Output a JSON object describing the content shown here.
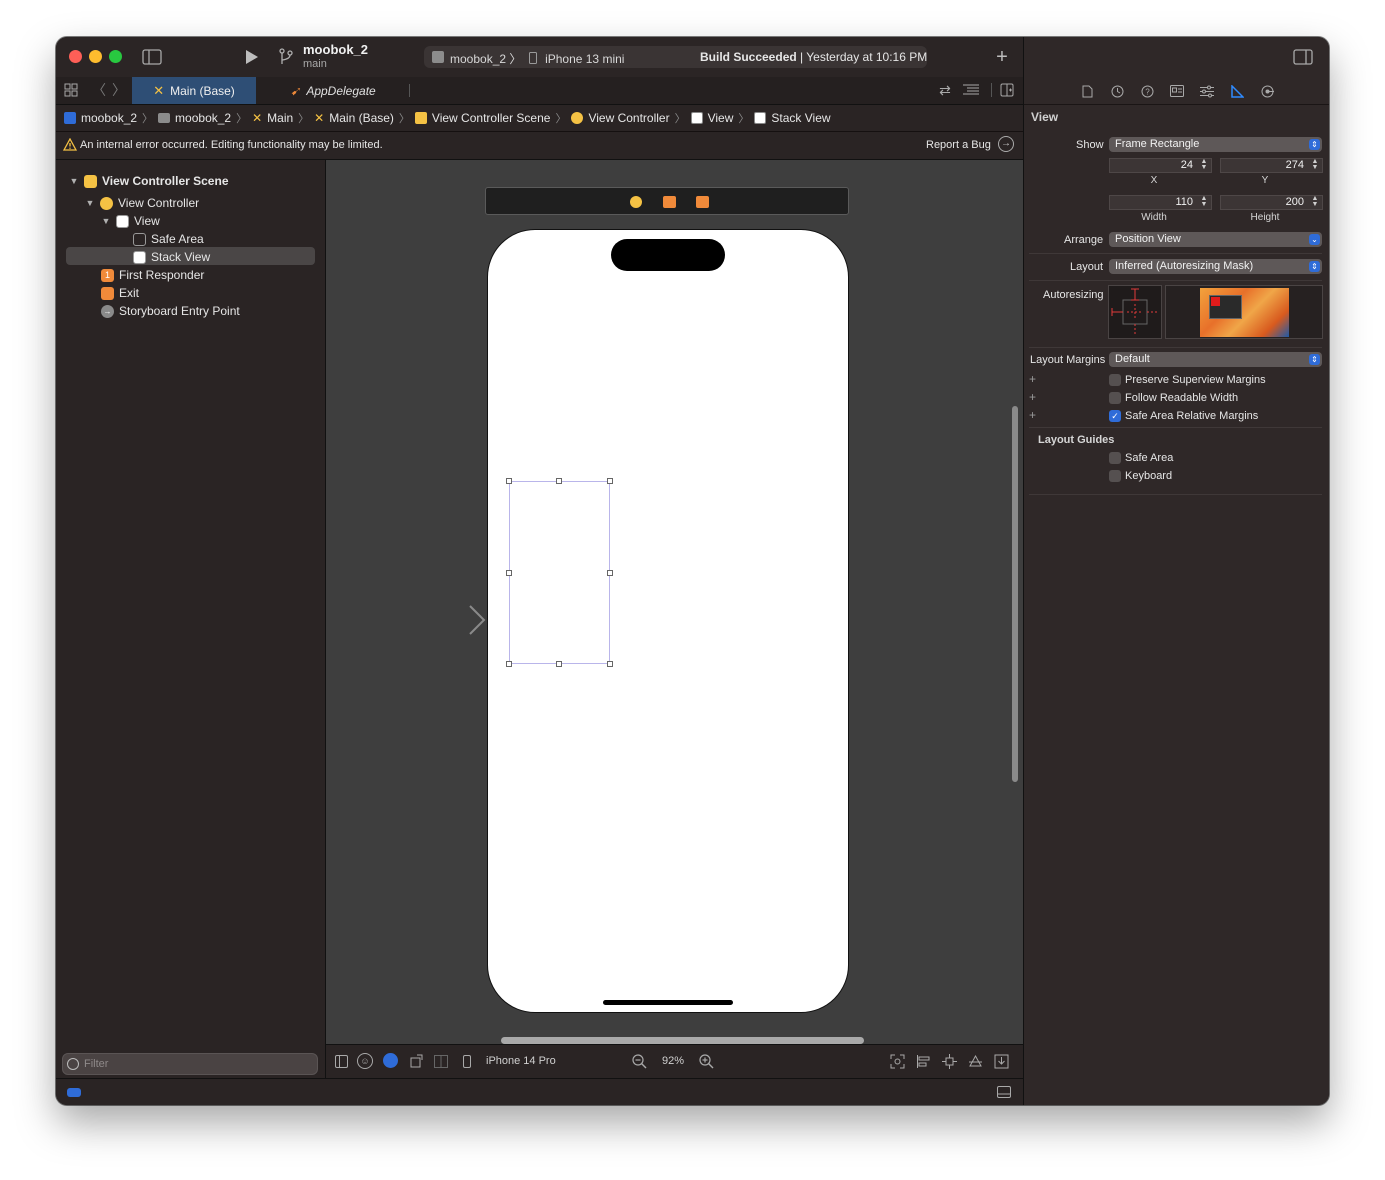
{
  "titlebar": {
    "project_name": "moobok_2",
    "branch": "main",
    "scheme": "moobok_2 〉",
    "device": "iPhone 13 mini",
    "build_status_bold": "Build Succeeded",
    "build_status_rest": " | Yesterday at 10:16 PM"
  },
  "tabs": [
    {
      "label": "Main (Base)"
    },
    {
      "label": "AppDelegate"
    }
  ],
  "jumpbar": [
    "moobok_2",
    "moobok_2",
    "Main",
    "Main (Base)",
    "View Controller Scene",
    "View Controller",
    "View",
    "Stack View"
  ],
  "warning": {
    "message": "An internal error occurred. Editing functionality may be limited.",
    "report": "Report a Bug"
  },
  "navigator": {
    "items": [
      {
        "label": "View Controller Scene"
      },
      {
        "label": "View Controller"
      },
      {
        "label": "View"
      },
      {
        "label": "Safe Area"
      },
      {
        "label": "Stack View"
      },
      {
        "label": "First Responder"
      },
      {
        "label": "Exit"
      },
      {
        "label": "Storyboard Entry Point"
      }
    ],
    "filter_placeholder": "Filter"
  },
  "canvas": {
    "device": "iPhone 14 Pro",
    "zoom": "92%"
  },
  "inspector": {
    "section_title": "View",
    "show_label": "Show",
    "show_value": "Frame Rectangle",
    "x_value": "24",
    "y_value": "274",
    "x_label": "X",
    "y_label": "Y",
    "width_value": "110",
    "height_value": "200",
    "width_label": "Width",
    "height_label": "Height",
    "arrange_label": "Arrange",
    "arrange_value": "Position View",
    "layout_label": "Layout",
    "layout_value": "Inferred (Autoresizing Mask)",
    "autoresizing_label": "Autoresizing",
    "layout_margins_label": "Layout Margins",
    "layout_margins_value": "Default",
    "preserve_superview": "Preserve Superview Margins",
    "follow_readable": "Follow Readable Width",
    "safe_area_relative": "Safe Area Relative Margins",
    "safe_area_relative_checked": true,
    "layout_guides_title": "Layout Guides",
    "guide_safe_area": "Safe Area",
    "guide_keyboard": "Keyboard"
  },
  "colors": {
    "accent": "#2f6cd8",
    "selected_tab": "#2e4e75",
    "warning": "#f5c244",
    "storyboard_orange": "#f08a3a",
    "stack_outline": "#b9b5ea"
  }
}
